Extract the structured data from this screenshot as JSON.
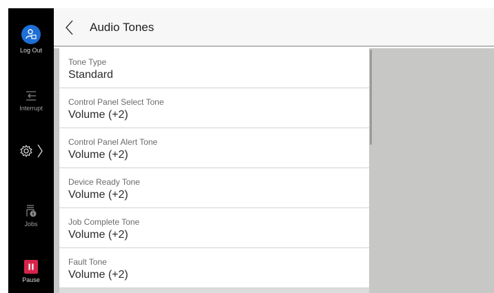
{
  "sidebar": {
    "logout_label": "Log Out",
    "interrupt_label": "Interrupt",
    "jobs_label": "Jobs",
    "pause_label": "Pause"
  },
  "header": {
    "title": "Audio Tones"
  },
  "list": {
    "items": [
      {
        "label": "Tone Type",
        "value": "Standard"
      },
      {
        "label": "Control Panel Select Tone",
        "value": "Volume (+2)"
      },
      {
        "label": "Control Panel Alert Tone",
        "value": "Volume (+2)"
      },
      {
        "label": "Device Ready Tone",
        "value": "Volume (+2)"
      },
      {
        "label": "Job Complete Tone",
        "value": "Volume (+2)"
      },
      {
        "label": "Fault Tone",
        "value": "Volume (+2)"
      }
    ]
  },
  "colors": {
    "logout_accent": "#1d6fd6",
    "pause_accent": "#d8244a"
  }
}
